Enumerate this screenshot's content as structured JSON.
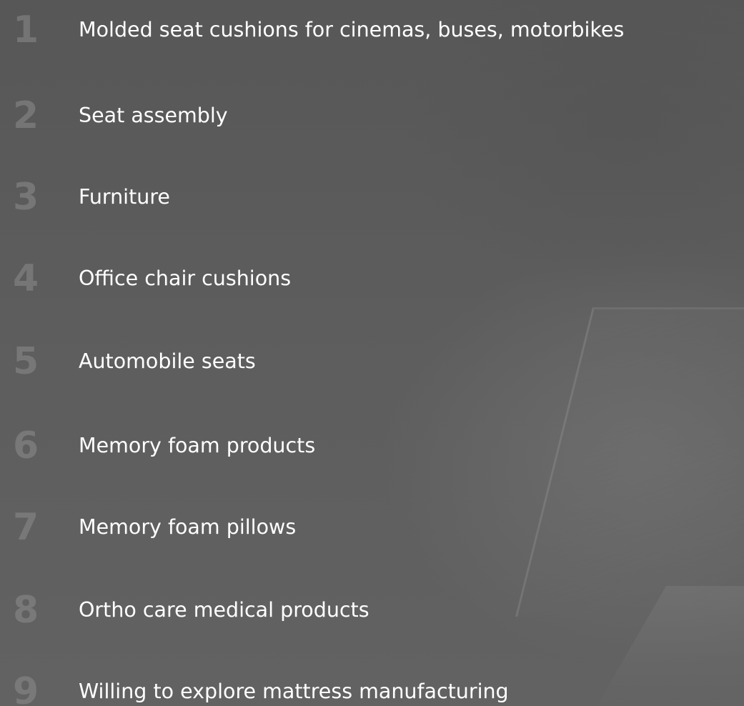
{
  "items": [
    {
      "number": "1",
      "label": "Molded seat cushions for cinemas, buses, motorbikes"
    },
    {
      "number": "2",
      "label": "Seat assembly"
    },
    {
      "number": "3",
      "label": "Furniture"
    },
    {
      "number": "4",
      "label": "Office chair cushions"
    },
    {
      "number": "5",
      "label": "Automobile seats"
    },
    {
      "number": "6",
      "label": "Memory foam products"
    },
    {
      "number": "7",
      "label": "Memory foam pillows"
    },
    {
      "number": "8",
      "label": "Ortho care medical products"
    },
    {
      "number": "9",
      "label": "Willing to explore mattress manufacturing"
    }
  ],
  "colors": {
    "background": "#5e5e5e",
    "text": "#ffffff",
    "number": "#9a9a9a"
  }
}
